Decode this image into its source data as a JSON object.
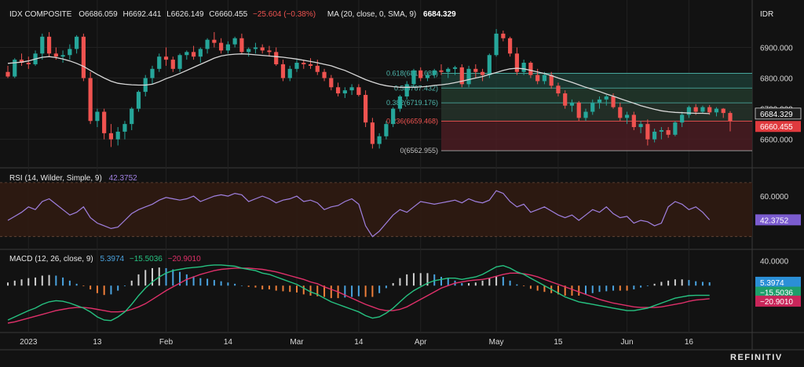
{
  "brand": "REFINITIV",
  "currency": "IDR",
  "chart_data": [
    {
      "type": "candlestick",
      "header": {
        "symbol": "IDX COMPOSITE",
        "open": "O6686.059",
        "high": "H6692.441",
        "low": "L6626.149",
        "close": "C6660.455",
        "change": "−25.604 (−0.38%)",
        "ma_label": "MA (20, close, 0, SMA, 9)",
        "ma_value": "6684.329"
      },
      "yticks": [
        6600,
        6700,
        6800,
        6900
      ],
      "ytick_labels": [
        "6600.000",
        "6700.000",
        "6800.000",
        "6900.000"
      ],
      "ylim": [
        6548,
        6978
      ],
      "last_ma_label": "6684.329",
      "last_close_label": "6660.455",
      "colors": {
        "up": "#26a69a",
        "down": "#ef5350",
        "ma": "#d8d8d8"
      },
      "candles": [
        [
          6820,
          6840,
          6800,
          6805
        ],
        [
          6805,
          6865,
          6800,
          6860
        ],
        [
          6860,
          6880,
          6840,
          6850
        ],
        [
          6850,
          6870,
          6830,
          6845
        ],
        [
          6845,
          6890,
          6840,
          6880
        ],
        [
          6880,
          6945,
          6860,
          6935
        ],
        [
          6935,
          6950,
          6870,
          6880
        ],
        [
          6880,
          6900,
          6860,
          6870
        ],
        [
          6870,
          6890,
          6850,
          6875
        ],
        [
          6875,
          6910,
          6860,
          6895
        ],
        [
          6895,
          6940,
          6880,
          6935
        ],
        [
          6935,
          6945,
          6790,
          6800
        ],
        [
          6800,
          6820,
          6650,
          6660
        ],
        [
          6660,
          6700,
          6640,
          6690
        ],
        [
          6690,
          6700,
          6600,
          6620
        ],
        [
          6620,
          6650,
          6575,
          6600
        ],
        [
          6600,
          6640,
          6580,
          6625
        ],
        [
          6625,
          6660,
          6600,
          6650
        ],
        [
          6650,
          6705,
          6630,
          6700
        ],
        [
          6700,
          6760,
          6690,
          6755
        ],
        [
          6755,
          6810,
          6740,
          6800
        ],
        [
          6800,
          6840,
          6780,
          6830
        ],
        [
          6830,
          6880,
          6820,
          6870
        ],
        [
          6870,
          6900,
          6840,
          6860
        ],
        [
          6860,
          6870,
          6820,
          6830
        ],
        [
          6830,
          6880,
          6820,
          6875
        ],
        [
          6875,
          6890,
          6860,
          6885
        ],
        [
          6885,
          6905,
          6860,
          6870
        ],
        [
          6870,
          6900,
          6850,
          6895
        ],
        [
          6895,
          6930,
          6880,
          6925
        ],
        [
          6925,
          6950,
          6900,
          6915
        ],
        [
          6915,
          6930,
          6880,
          6890
        ],
        [
          6890,
          6920,
          6880,
          6910
        ],
        [
          6910,
          6935,
          6900,
          6930
        ],
        [
          6930,
          6945,
          6880,
          6885
        ],
        [
          6885,
          6900,
          6870,
          6895
        ],
        [
          6895,
          6915,
          6880,
          6900
        ],
        [
          6900,
          6910,
          6880,
          6890
        ],
        [
          6890,
          6905,
          6870,
          6885
        ],
        [
          6885,
          6900,
          6840,
          6845
        ],
        [
          6845,
          6860,
          6790,
          6800
        ],
        [
          6800,
          6840,
          6790,
          6830
        ],
        [
          6830,
          6860,
          6820,
          6850
        ],
        [
          6850,
          6860,
          6830,
          6845
        ],
        [
          6845,
          6865,
          6830,
          6840
        ],
        [
          6840,
          6860,
          6810,
          6820
        ],
        [
          6820,
          6830,
          6790,
          6800
        ],
        [
          6800,
          6810,
          6760,
          6770
        ],
        [
          6770,
          6785,
          6740,
          6750
        ],
        [
          6750,
          6770,
          6735,
          6760
        ],
        [
          6760,
          6780,
          6745,
          6770
        ],
        [
          6770,
          6780,
          6740,
          6745
        ],
        [
          6745,
          6760,
          6640,
          6655
        ],
        [
          6655,
          6670,
          6570,
          6585
        ],
        [
          6585,
          6620,
          6570,
          6610
        ],
        [
          6610,
          6660,
          6600,
          6650
        ],
        [
          6650,
          6705,
          6640,
          6700
        ],
        [
          6700,
          6745,
          6690,
          6740
        ],
        [
          6740,
          6790,
          6730,
          6780
        ],
        [
          6780,
          6830,
          6770,
          6825
        ],
        [
          6825,
          6835,
          6790,
          6800
        ],
        [
          6800,
          6820,
          6790,
          6810
        ],
        [
          6810,
          6830,
          6800,
          6825
        ],
        [
          6825,
          6845,
          6810,
          6820
        ],
        [
          6820,
          6835,
          6800,
          6830
        ],
        [
          6830,
          6840,
          6810,
          6835
        ],
        [
          6835,
          6845,
          6770,
          6780
        ],
        [
          6780,
          6840,
          6770,
          6830
        ],
        [
          6830,
          6845,
          6800,
          6820
        ],
        [
          6820,
          6830,
          6790,
          6810
        ],
        [
          6810,
          6880,
          6800,
          6875
        ],
        [
          6875,
          6960,
          6870,
          6945
        ],
        [
          6945,
          6955,
          6920,
          6930
        ],
        [
          6930,
          6935,
          6870,
          6880
        ],
        [
          6880,
          6900,
          6810,
          6820
        ],
        [
          6820,
          6860,
          6810,
          6850
        ],
        [
          6850,
          6855,
          6800,
          6810
        ],
        [
          6810,
          6830,
          6780,
          6790
        ],
        [
          6790,
          6820,
          6780,
          6810
        ],
        [
          6810,
          6820,
          6765,
          6775
        ],
        [
          6775,
          6785,
          6740,
          6750
        ],
        [
          6750,
          6760,
          6700,
          6710
        ],
        [
          6710,
          6730,
          6690,
          6720
        ],
        [
          6720,
          6725,
          6660,
          6670
        ],
        [
          6670,
          6700,
          6660,
          6690
        ],
        [
          6690,
          6730,
          6680,
          6720
        ],
        [
          6720,
          6740,
          6700,
          6730
        ],
        [
          6730,
          6745,
          6710,
          6740
        ],
        [
          6740,
          6750,
          6700,
          6705
        ],
        [
          6705,
          6720,
          6660,
          6670
        ],
        [
          6670,
          6690,
          6650,
          6680
        ],
        [
          6680,
          6690,
          6630,
          6640
        ],
        [
          6640,
          6660,
          6620,
          6650
        ],
        [
          6650,
          6665,
          6580,
          6600
        ],
        [
          6600,
          6635,
          6590,
          6625
        ],
        [
          6625,
          6640,
          6600,
          6630
        ],
        [
          6630,
          6640,
          6605,
          6615
        ],
        [
          6615,
          6660,
          6610,
          6655
        ],
        [
          6655,
          6690,
          6640,
          6680
        ],
        [
          6680,
          6710,
          6670,
          6705
        ],
        [
          6705,
          6715,
          6680,
          6690
        ],
        [
          6690,
          6710,
          6685,
          6705
        ],
        [
          6705,
          6712,
          6680,
          6688
        ],
        [
          6688,
          6705,
          6675,
          6700
        ],
        [
          6700,
          6702,
          6670,
          6686
        ],
        [
          6686,
          6692,
          6626,
          6660
        ]
      ],
      "ma": [
        6848,
        6850,
        6852,
        6856,
        6862,
        6868,
        6870,
        6867,
        6862,
        6856,
        6848,
        6838,
        6825,
        6812,
        6800,
        6790,
        6783,
        6780,
        6778,
        6777,
        6777,
        6780,
        6788,
        6798,
        6806,
        6815,
        6825,
        6835,
        6845,
        6855,
        6865,
        6872,
        6876,
        6878,
        6879,
        6878,
        6876,
        6874,
        6872,
        6870,
        6868,
        6865,
        6862,
        6858,
        6854,
        6850,
        6845,
        6840,
        6832,
        6825,
        6815,
        6805,
        6795,
        6787,
        6780,
        6775,
        6772,
        6770,
        6770,
        6770,
        6771,
        6773,
        6776,
        6778,
        6781,
        6785,
        6790,
        6795,
        6800,
        6805,
        6812,
        6818,
        6825,
        6830,
        6832,
        6830,
        6825,
        6820,
        6815,
        6808,
        6800,
        6793,
        6786,
        6778,
        6770,
        6763,
        6756,
        6748,
        6741,
        6733,
        6725,
        6718,
        6710,
        6704,
        6698,
        6693,
        6690,
        6688,
        6687,
        6686,
        6685,
        6685,
        6684
      ],
      "fibonacci": {
        "levels": [
          {
            "label": "0.618(6815.689)",
            "value": 6815.689
          },
          {
            "label": "0.5(6767.432)",
            "value": 6767.432
          },
          {
            "label": "0.382(6719.176)",
            "value": 6719.176
          },
          {
            "label": "0.236(6659.468)",
            "value": 6659.468
          },
          {
            "label": "0(6562.955)",
            "value": 6562.955
          }
        ],
        "zone_colors": [
          "#1c3b34",
          "#22382b",
          "#26322a",
          "#4a1c22"
        ]
      },
      "xticks": [
        {
          "label": "2023",
          "index": 3
        },
        {
          "label": "13",
          "index": 13
        },
        {
          "label": "Feb",
          "index": 23
        },
        {
          "label": "14",
          "index": 32
        },
        {
          "label": "Mar",
          "index": 42
        },
        {
          "label": "14",
          "index": 51
        },
        {
          "label": "Apr",
          "index": 60
        },
        {
          "label": "May",
          "index": 71
        },
        {
          "label": "15",
          "index": 80
        },
        {
          "label": "Jun",
          "index": 90
        },
        {
          "label": "16",
          "index": 99
        }
      ]
    },
    {
      "type": "line",
      "header": "RSI (14, Wilder, Simple, 9)",
      "value_label": "42.3752",
      "ytick_labels": [
        "60.0000"
      ],
      "yticks": [
        60
      ],
      "ylim": [
        24,
        74
      ],
      "band": [
        30,
        70
      ],
      "color": "#a080e0",
      "values": [
        42,
        45,
        48,
        52,
        50,
        56,
        58,
        54,
        50,
        46,
        48,
        52,
        44,
        40,
        38,
        36,
        37,
        42,
        47,
        50,
        52,
        54,
        57,
        59,
        58,
        57,
        58,
        60,
        56,
        58,
        60,
        61,
        60,
        62,
        61,
        56,
        58,
        60,
        58,
        55,
        57,
        58,
        60,
        56,
        57,
        55,
        50,
        52,
        53,
        56,
        58,
        54,
        38,
        30,
        34,
        40,
        46,
        50,
        48,
        52,
        56,
        55,
        54,
        55,
        56,
        57,
        55,
        58,
        56,
        55,
        57,
        64,
        62,
        56,
        52,
        54,
        48,
        50,
        52,
        49,
        46,
        44,
        46,
        42,
        46,
        50,
        48,
        52,
        47,
        44,
        45,
        40,
        42,
        41,
        38,
        40,
        52,
        56,
        54,
        50,
        52,
        48,
        42.4
      ]
    },
    {
      "type": "bar+line",
      "header": "MACD (12, 26, close, 9)",
      "macd_label": "5.3974",
      "signal_label": "−15.5036",
      "hist_label": "−20.9010",
      "ytick_labels": [
        "40.0000"
      ],
      "yticks": [
        40
      ],
      "ylim": [
        -70,
        48
      ],
      "colors": {
        "macd": "#26c281",
        "signal": "#e0306a",
        "hist_pos_rising": "#d0d0d0",
        "hist_pos_falling": "#4aa3df",
        "hist_neg_falling": "#ef7f3a",
        "hist_neg_rising": "#4aa3df"
      },
      "macd": [
        -55,
        -50,
        -45,
        -40,
        -36,
        -30,
        -26,
        -24,
        -25,
        -28,
        -32,
        -36,
        -42,
        -50,
        -55,
        -56,
        -50,
        -42,
        -30,
        -16,
        -4,
        6,
        14,
        20,
        24,
        26,
        28,
        29,
        30,
        32,
        33,
        33,
        32,
        31,
        28,
        26,
        24,
        20,
        18,
        14,
        10,
        6,
        2,
        -4,
        -10,
        -14,
        -20,
        -26,
        -30,
        -34,
        -38,
        -42,
        -48,
        -52,
        -50,
        -44,
        -36,
        -26,
        -16,
        -8,
        -2,
        4,
        8,
        10,
        12,
        12,
        10,
        12,
        14,
        18,
        24,
        30,
        32,
        28,
        22,
        18,
        12,
        6,
        0,
        -6,
        -12,
        -18,
        -22,
        -26,
        -28,
        -30,
        -32,
        -34,
        -36,
        -38,
        -40,
        -40,
        -38,
        -36,
        -32,
        -28,
        -24,
        -20,
        -18,
        -16,
        -15.5,
        -15.5,
        -15.5
      ],
      "signal": [
        -60,
        -58,
        -55,
        -52,
        -49,
        -46,
        -43,
        -40,
        -38,
        -36,
        -35,
        -35,
        -36,
        -38,
        -40,
        -42,
        -42,
        -41,
        -38,
        -34,
        -29,
        -22,
        -15,
        -8,
        -2,
        4,
        10,
        14,
        18,
        21,
        24,
        26,
        27,
        28,
        28,
        28,
        27,
        26,
        24,
        22,
        19,
        16,
        13,
        10,
        6,
        3,
        -2,
        -6,
        -10,
        -15,
        -20,
        -25,
        -30,
        -34,
        -38,
        -40,
        -40,
        -38,
        -34,
        -28,
        -22,
        -16,
        -10,
        -4,
        0,
        4,
        6,
        8,
        9,
        10,
        12,
        15,
        18,
        20,
        20,
        19,
        17,
        14,
        10,
        6,
        2,
        -2,
        -6,
        -10,
        -14,
        -18,
        -22,
        -25,
        -28,
        -30,
        -32,
        -34,
        -35,
        -35,
        -35,
        -34,
        -32,
        -30,
        -28,
        -25,
        -23,
        -22,
        -20.9
      ],
      "hist": [
        5,
        8,
        10,
        12,
        13,
        16,
        17,
        16,
        13,
        8,
        3,
        -1,
        -6,
        -12,
        -15,
        -14,
        -8,
        -1,
        8,
        18,
        25,
        28,
        29,
        28,
        26,
        22,
        18,
        15,
        12,
        11,
        9,
        7,
        5,
        3,
        0,
        -2,
        -3,
        -6,
        -6,
        -8,
        -9,
        -10,
        -11,
        -14,
        -16,
        -17,
        -18,
        -20,
        -20,
        -19,
        -18,
        -17,
        -18,
        -18,
        -12,
        -4,
        4,
        12,
        18,
        20,
        20,
        20,
        18,
        14,
        12,
        8,
        4,
        4,
        5,
        8,
        12,
        15,
        14,
        8,
        2,
        -1,
        -5,
        -8,
        -10,
        -12,
        -14,
        -16,
        -16,
        -16,
        -14,
        -12,
        -10,
        -9,
        -8,
        -8,
        -8,
        -6,
        -3,
        -1,
        3,
        6,
        8,
        10,
        10,
        9,
        7,
        6,
        5.4
      ]
    }
  ]
}
